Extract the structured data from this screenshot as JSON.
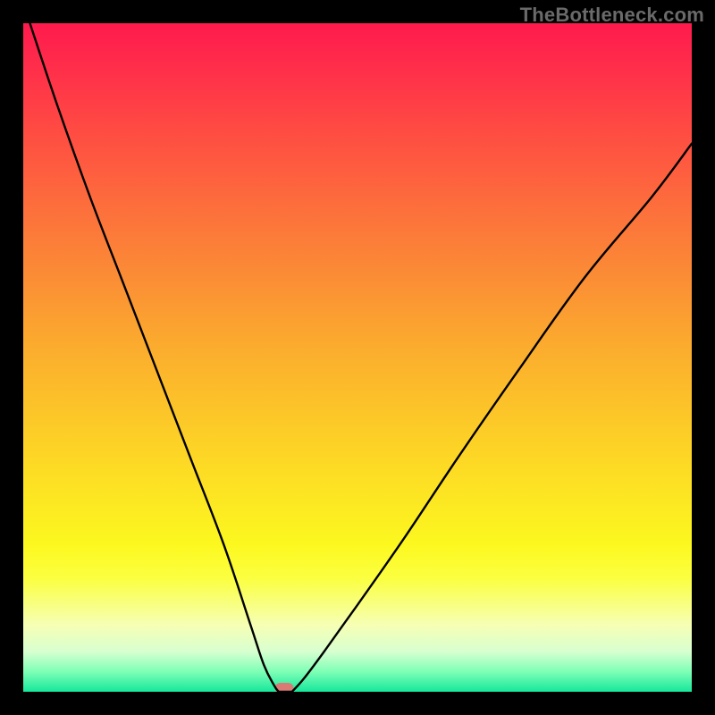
{
  "watermark": "TheBottleneck.com",
  "colors": {
    "frame": "#000000",
    "gradient_top": "#ff1a4d",
    "gradient_mid": "#fdd725",
    "gradient_bottom": "#16e79b",
    "curve": "#000000",
    "marker": "#d97b74"
  },
  "chart_data": {
    "type": "line",
    "title": "",
    "xlabel": "",
    "ylabel": "",
    "xlim": [
      0,
      100
    ],
    "ylim": [
      0,
      100
    ],
    "annotations": [],
    "marker": {
      "x": 39,
      "y": 0
    },
    "left_segment": {
      "x": [
        1,
        5,
        10,
        15,
        20,
        25,
        30,
        34,
        36,
        37.5,
        38.2
      ],
      "y": [
        100,
        88,
        74,
        61,
        48,
        35,
        22,
        10,
        4,
        1,
        0
      ]
    },
    "right_segment": {
      "x": [
        40.2,
        42,
        45,
        50,
        57,
        65,
        74,
        84,
        94,
        100
      ],
      "y": [
        0,
        2,
        6,
        13,
        23,
        35,
        48,
        62,
        74,
        82
      ]
    },
    "flat_segment": {
      "x": [
        38.2,
        40.2
      ],
      "y": [
        0,
        0
      ]
    }
  }
}
